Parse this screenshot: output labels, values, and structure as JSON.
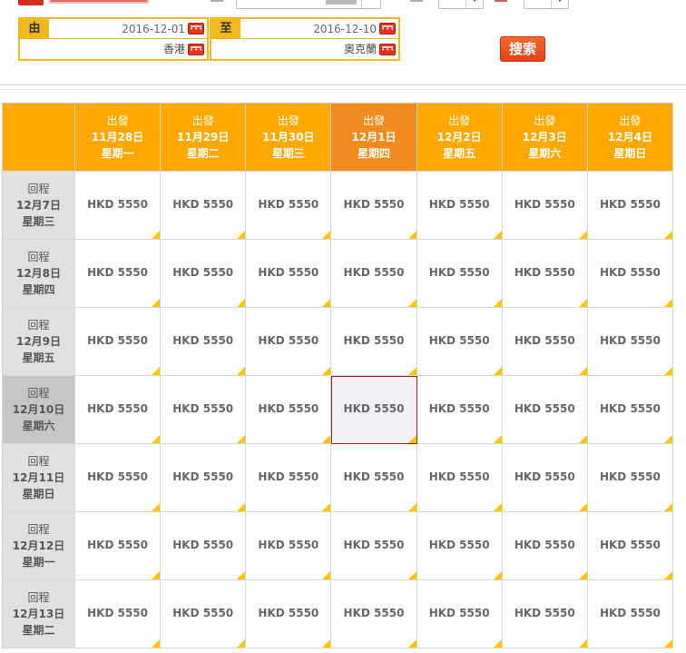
{
  "search": {
    "from_label": "由",
    "to_label": "至",
    "depart_date": "2016-12-01",
    "return_date": "2016-12-10",
    "origin_city": "香港",
    "destination_city": "奧克蘭",
    "search_label": "搜索"
  },
  "grid": {
    "outbound_label": "出發",
    "return_label": "回程",
    "departures": [
      {
        "date": "11月28日",
        "weekday": "星期一"
      },
      {
        "date": "11月29日",
        "weekday": "星期二"
      },
      {
        "date": "11月30日",
        "weekday": "星期三"
      },
      {
        "date": "12月1日",
        "weekday": "星期四"
      },
      {
        "date": "12月2日",
        "weekday": "星期五"
      },
      {
        "date": "12月3日",
        "weekday": "星期六"
      },
      {
        "date": "12月4日",
        "weekday": "星期日"
      }
    ],
    "returns": [
      {
        "date": "12月7日",
        "weekday": "星期三"
      },
      {
        "date": "12月8日",
        "weekday": "星期四"
      },
      {
        "date": "12月9日",
        "weekday": "星期五"
      },
      {
        "date": "12月10日",
        "weekday": "星期六"
      },
      {
        "date": "12月11日",
        "weekday": "星期日"
      },
      {
        "date": "12月12日",
        "weekday": "星期一"
      },
      {
        "date": "12月13日",
        "weekday": "星期二"
      }
    ],
    "fares": [
      [
        "HKD 5550",
        "HKD 5550",
        "HKD 5550",
        "HKD 5550",
        "HKD 5550",
        "HKD 5550",
        "HKD 5550"
      ],
      [
        "HKD 5550",
        "HKD 5550",
        "HKD 5550",
        "HKD 5550",
        "HKD 5550",
        "HKD 5550",
        "HKD 5550"
      ],
      [
        "HKD 5550",
        "HKD 5550",
        "HKD 5550",
        "HKD 5550",
        "HKD 5550",
        "HKD 5550",
        "HKD 5550"
      ],
      [
        "HKD 5550",
        "HKD 5550",
        "HKD 5550",
        "HKD 5550",
        "HKD 5550",
        "HKD 5550",
        "HKD 5550"
      ],
      [
        "HKD 5550",
        "HKD 5550",
        "HKD 5550",
        "HKD 5550",
        "HKD 5550",
        "HKD 5550",
        "HKD 5550"
      ],
      [
        "HKD 5550",
        "HKD 5550",
        "HKD 5550",
        "HKD 5550",
        "HKD 5550",
        "HKD 5550",
        "HKD 5550"
      ],
      [
        "HKD 5550",
        "HKD 5550",
        "HKD 5550",
        "HKD 5550",
        "HKD 5550",
        "HKD 5550",
        "HKD 5550"
      ]
    ],
    "selected": {
      "row": 3,
      "col": 3
    }
  },
  "colors": {
    "header_orange": "#ffa800",
    "highlight_orange": "#f28a1d",
    "accent_red": "#d62b1f",
    "flag_yellow": "#ffc400"
  },
  "icons": {
    "calendar": "calendar-icon",
    "dropdown": "chevron-down-icon"
  }
}
